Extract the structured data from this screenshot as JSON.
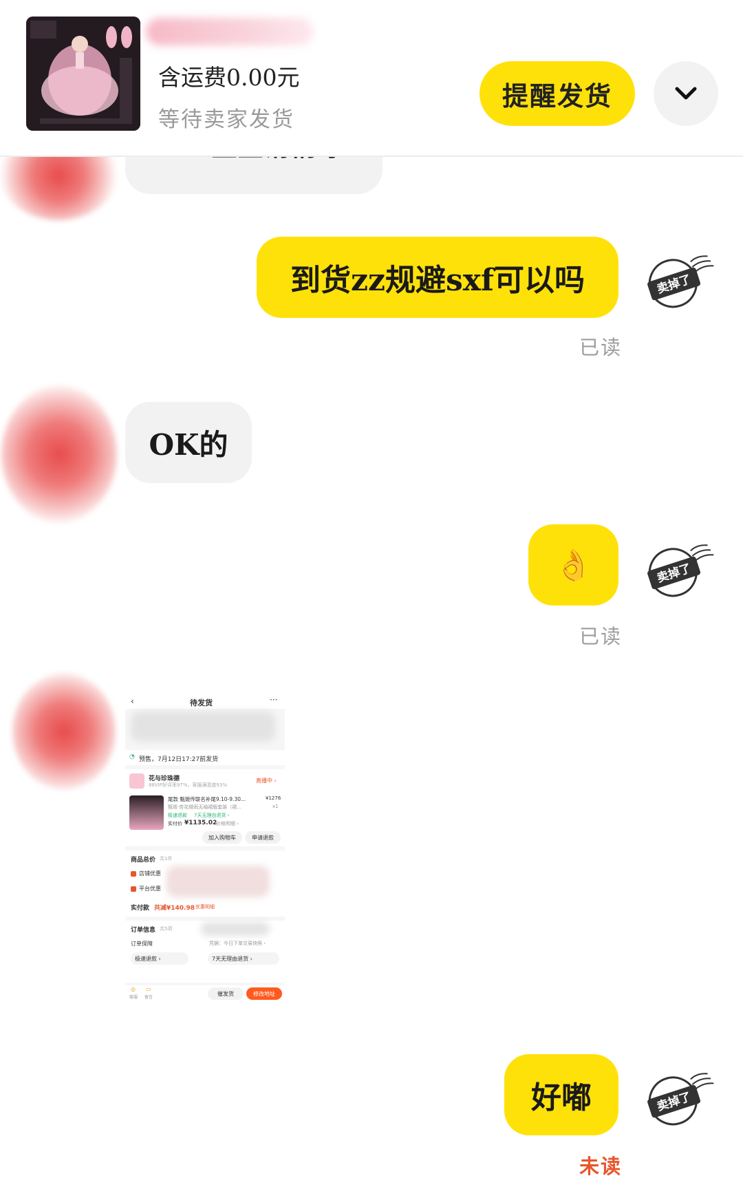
{
  "header": {
    "price_label": "含运费0.00元",
    "order_status": "等待卖家发货",
    "remind_button": "提醒发货",
    "expand_icon": "chevron-down-icon"
  },
  "messages": [
    {
      "side": "left",
      "text": "OK宝宝请稍等",
      "partial": true
    },
    {
      "side": "right",
      "text": "到货zz规避sxf可以吗",
      "status": "已读",
      "stamp": "卖掉了"
    },
    {
      "side": "left",
      "text": "OK的"
    },
    {
      "side": "right",
      "text": "👌",
      "status": "已读",
      "stamp": "卖掉了"
    },
    {
      "side": "left",
      "type": "image",
      "description_id": "order-screenshot"
    },
    {
      "side": "right",
      "text": "好嘟",
      "status": "未读",
      "stamp": "卖掉了"
    }
  ],
  "order_screenshot": {
    "title": "待发货",
    "presale_note": "预售，7月12日17:27前发货",
    "shop_name": "花与珍珠德",
    "shop_sub": "88VIP好评率97%，客服满意度93%",
    "live_badge": "直播中 ›",
    "item_title": "尾款 甄姬传联名补尾9.10-9.30...",
    "item_price": "¥1276",
    "item_spec": "甄姬·杏花微雨无袖裙版套装（裙...",
    "item_qty": "x1",
    "tag_fast": "极速退款",
    "tag_7day": "7天无理由退货 ›",
    "paid_label": "实付价",
    "paid_value": "¥1135.02",
    "paid_detail": "价格明细 ›",
    "btn_cart": "加入购物车",
    "btn_refund": "申请退款",
    "total_label": "商品总价",
    "total_count": "共1件",
    "shop_discount": "店铺优惠",
    "platform_discount": "平台优惠",
    "actual_label": "实付款",
    "actual_saving": "共减¥140.98",
    "actual_saving_note": "优惠明细",
    "order_info": "订单信息",
    "order_info_count": "共5项",
    "order_guarantee": "订单保障",
    "guarantee_note": "凭据：今日下单交易快照 ›",
    "tag_fast2": "极速退款 ›",
    "tag_7day2": "7天无理由退货 ›",
    "footer_btn_remind": "催发货",
    "footer_btn_address": "修改地址",
    "footer_icon1": "客服",
    "footer_icon2": "留言"
  },
  "colors": {
    "accent_yellow": "#ffe10a",
    "bubble_gray": "#f2f2f2",
    "read_gray": "#9d9d9d",
    "unread_orange": "#e8552a"
  }
}
